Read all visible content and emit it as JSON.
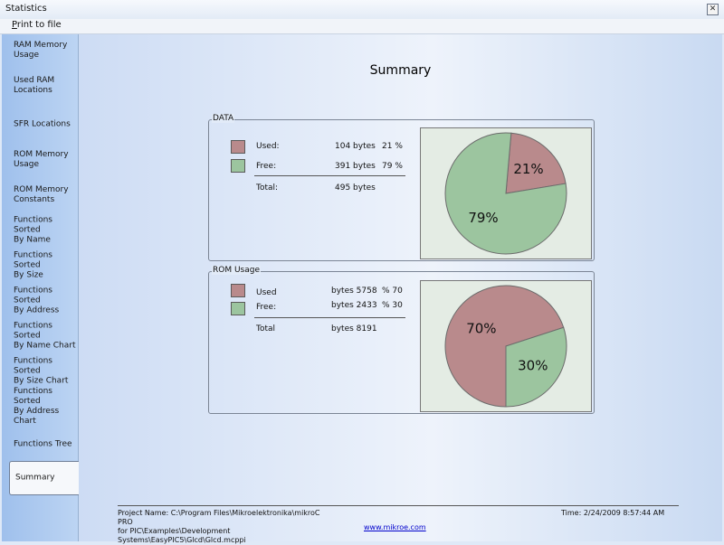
{
  "window": {
    "title": "Statistics",
    "close_glyph": "✕"
  },
  "menu": {
    "print_underlined": "P",
    "print_rest": "rint to file"
  },
  "sidebar": {
    "items": [
      {
        "label": "RAM Memory\nUsage"
      },
      {
        "label": "Used RAM\nLocations"
      },
      {
        "label": "SFR Locations"
      },
      {
        "label": "ROM Memory\nUsage"
      },
      {
        "label": "ROM Memory\nConstants"
      },
      {
        "label": "Functions Sorted\nBy  Name"
      },
      {
        "label": "Functions Sorted\nBy Size"
      },
      {
        "label": "Functions Sorted\nBy Address"
      },
      {
        "label": "Functions Sorted\nBy Name Chart"
      },
      {
        "label": "Functions Sorted\nBy Size Chart"
      },
      {
        "label": "Functions Sorted\nBy Address Chart"
      },
      {
        "label": "Functions Tree"
      },
      {
        "label": "Summary"
      }
    ],
    "active_index": 12
  },
  "main": {
    "title": "Summary",
    "data_group": {
      "label": "DATA",
      "used_label": "Used:",
      "used_value": "104 bytes",
      "used_pct": "21 %",
      "free_label": "Free:",
      "free_value": "391 bytes",
      "free_pct": "79 %",
      "total_label": "Total:",
      "total_value": "495 bytes",
      "pie_used_label": "21%",
      "pie_free_label": "79%"
    },
    "rom_group": {
      "label": "ROM Usage",
      "used_label": "Used",
      "used_value": "bytes 5758",
      "used_pct": "% 70",
      "free_label": "Free:",
      "free_value": "bytes 2433",
      "free_pct": "% 30",
      "total_label": "Total",
      "total_value": "bytes 8191",
      "pie_used_label": "70%",
      "pie_free_label": "30%"
    }
  },
  "footer": {
    "project_line1": "Project Name: C:\\Program Files\\Mikroelektronika\\mikroC PRO",
    "project_line2": "for PIC\\Examples\\Development",
    "project_line3": "Systems\\EasyPIC5\\Glcd\\Glcd.mcppi",
    "time": "Time: 2/24/2009 8:57:44 AM",
    "link": "www.mikroe.com"
  },
  "colors": {
    "used_fill": "#b98a8c",
    "free_fill": "#9cc59f",
    "pie_bg": "#e4ece4"
  },
  "chart_data": [
    {
      "type": "pie",
      "title": "DATA",
      "categories": [
        "Used",
        "Free"
      ],
      "values": [
        21,
        79
      ],
      "bytes": [
        104,
        391
      ],
      "total_bytes": 495
    },
    {
      "type": "pie",
      "title": "ROM Usage",
      "categories": [
        "Used",
        "Free"
      ],
      "values": [
        70,
        30
      ],
      "bytes": [
        5758,
        2433
      ],
      "total_bytes": 8191
    }
  ]
}
